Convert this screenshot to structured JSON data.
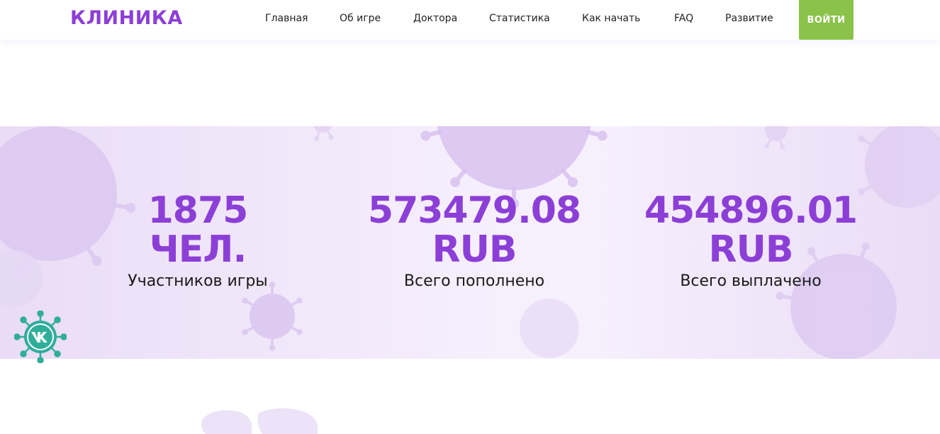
{
  "header": {
    "logo": "КЛИНИКА",
    "nav": [
      {
        "label": "Главная"
      },
      {
        "label": "Об игре"
      },
      {
        "label": "Доктора"
      },
      {
        "label": "Статистика"
      },
      {
        "label": "Как начать"
      },
      {
        "label": "FAQ"
      },
      {
        "label": "Развитие"
      }
    ],
    "login_label": "ВОЙТИ"
  },
  "stats": [
    {
      "value_line1": "1875",
      "value_line2": "ЧЕЛ.",
      "label": "Участников игры"
    },
    {
      "value_line1": "573479.08",
      "value_line2": "RUB",
      "label": "Всего пополнено"
    },
    {
      "value_line1": "454896.01",
      "value_line2": "RUB",
      "label": "Всего выплачено"
    }
  ],
  "vk_widget": {
    "icon": "vk-icon"
  },
  "colors": {
    "brand": "#8c3fd6",
    "login": "#8bc34a",
    "band_light": "#f3ebfb",
    "virus": "#d9c4f0",
    "vk": "#2fae9a"
  }
}
